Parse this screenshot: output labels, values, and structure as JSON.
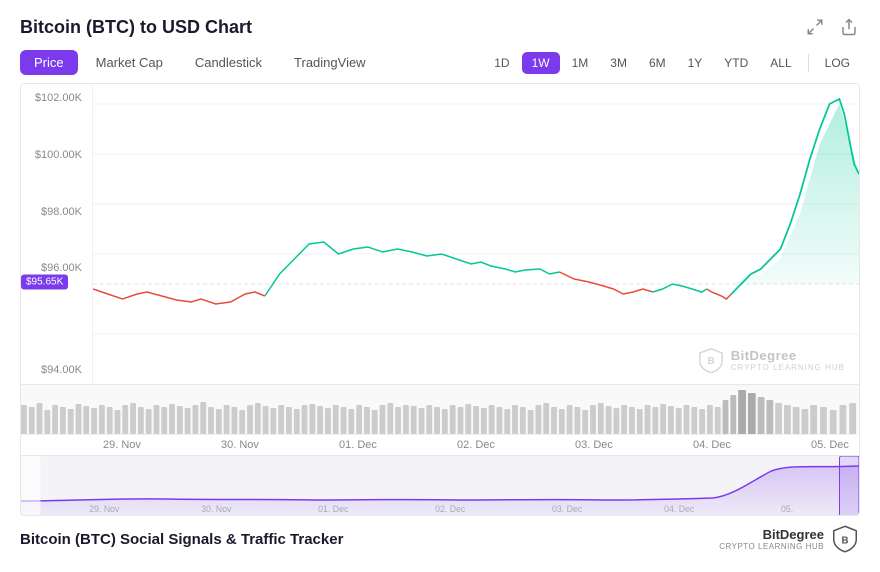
{
  "header": {
    "title": "Bitcoin (BTC) to USD Chart",
    "expand_label": "expand",
    "share_label": "share"
  },
  "left_tabs": [
    {
      "id": "price",
      "label": "Price",
      "active": true
    },
    {
      "id": "marketcap",
      "label": "Market Cap",
      "active": false
    },
    {
      "id": "candlestick",
      "label": "Candlestick",
      "active": false
    },
    {
      "id": "tradingview",
      "label": "TradingView",
      "active": false
    }
  ],
  "right_tabs": [
    {
      "id": "1d",
      "label": "1D",
      "active": false
    },
    {
      "id": "1w",
      "label": "1W",
      "active": true
    },
    {
      "id": "1m",
      "label": "1M",
      "active": false
    },
    {
      "id": "3m",
      "label": "3M",
      "active": false
    },
    {
      "id": "6m",
      "label": "6M",
      "active": false
    },
    {
      "id": "1y",
      "label": "1Y",
      "active": false
    },
    {
      "id": "ytd",
      "label": "YTD",
      "active": false
    },
    {
      "id": "all",
      "label": "ALL",
      "active": false
    },
    {
      "id": "log",
      "label": "LOG",
      "active": false
    }
  ],
  "y_axis": {
    "labels": [
      "$102.00K",
      "$100.00K",
      "$98.00K",
      "$96.00K",
      "$95.65K",
      "$94.00K"
    ]
  },
  "x_axis": {
    "labels": [
      "29. Nov",
      "30. Nov",
      "01. Dec",
      "02. Dec",
      "03. Dec",
      "04. Dec",
      "05. Dec"
    ]
  },
  "price_label": "$95.65K",
  "watermark": {
    "name": "BitDegree",
    "sub": "CRYPTO LEARNING HUB"
  },
  "footer": {
    "title": "Bitcoin (BTC) Social Signals & Traffic Tracker",
    "logo_name": "BitDegree",
    "logo_sub": "CRYPTO LEARNING HUB"
  }
}
